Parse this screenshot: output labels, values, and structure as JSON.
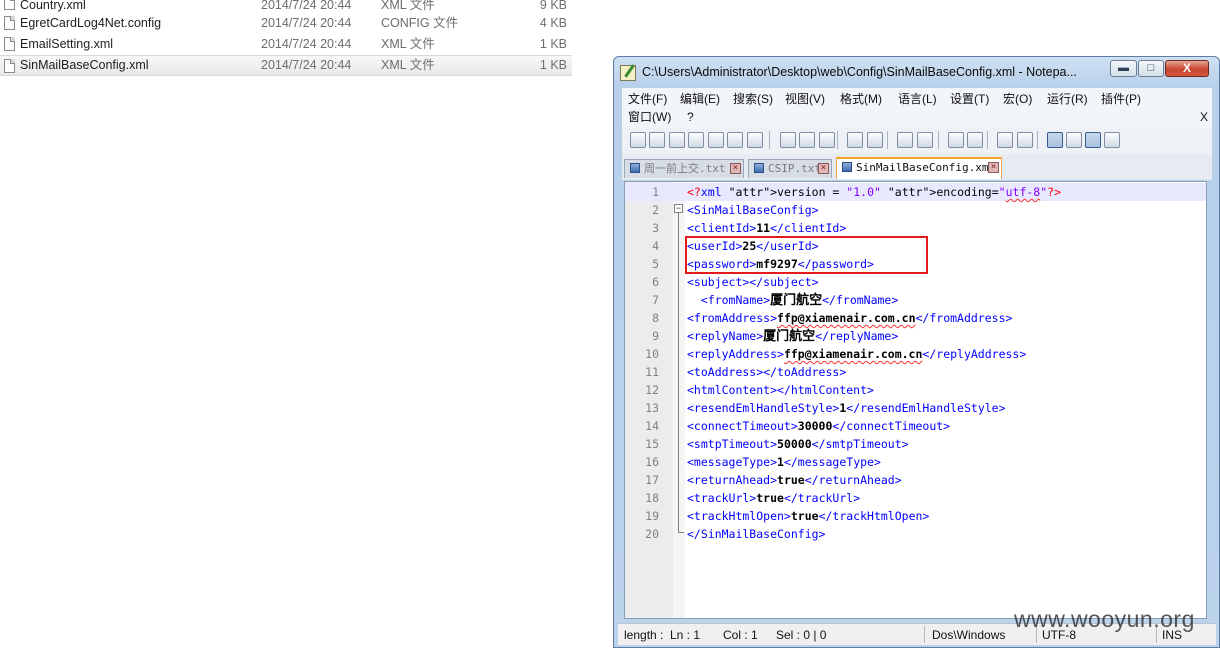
{
  "files": [
    {
      "name": "Country.xml",
      "date": "2014/7/24 20:44",
      "type": "XML 文件",
      "size": "9 KB"
    },
    {
      "name": "EgretCardLog4Net.config",
      "date": "2014/7/24 20:44",
      "type": "CONFIG 文件",
      "size": "4 KB"
    },
    {
      "name": "EmailSetting.xml",
      "date": "2014/7/24 20:44",
      "type": "XML 文件",
      "size": "1 KB"
    },
    {
      "name": "SinMailBaseConfig.xml",
      "date": "2014/7/24 20:44",
      "type": "XML 文件",
      "size": "1 KB"
    }
  ],
  "window": {
    "title": "C:\\Users\\Administrator\\Desktop\\web\\Config\\SinMailBaseConfig.xml - Notepa...",
    "close_glyph": "X"
  },
  "menu": {
    "items": [
      "文件(F)",
      "编辑(E)",
      "搜索(S)",
      "视图(V)",
      "格式(M)",
      "语言(L)",
      "设置(T)",
      "宏(O)",
      "运行(R)",
      "插件(P)",
      "窗口(W)",
      "?"
    ],
    "close": "X"
  },
  "toolbar": {
    "icons": [
      "new-file-icon",
      "open-file-icon",
      "save-icon",
      "save-all-icon",
      "close-file-icon",
      "close-all-icon",
      "print-icon",
      "cut-icon",
      "copy-icon",
      "paste-icon",
      "undo-icon",
      "redo-icon",
      "find-icon",
      "replace-icon",
      "zoom-in-icon",
      "zoom-out-icon",
      "sync-vertical-icon",
      "sync-horizontal-icon",
      "word-wrap-icon",
      "show-all-chars-icon",
      "indent-guide-icon",
      "user-lang-icon"
    ]
  },
  "tabs": [
    {
      "label": "周一前上交.txt",
      "active": false
    },
    {
      "label": "CSIP.txt",
      "active": false
    },
    {
      "label": "SinMailBaseConfig.xml",
      "active": true
    }
  ],
  "editor": {
    "current_line": 1,
    "lines": [
      "<?xml version = \"1.0\" encoding=\"utf-8\"?>",
      "<SinMailBaseConfig>",
      "<clientId>11</clientId>",
      "<userId>25</userId>",
      "<password>mf9297</password>",
      "<subject></subject>",
      "  <fromName>厦门航空</fromName>",
      "<fromAddress>ffp@xiamenair.com.cn</fromAddress>",
      "<replyName>厦门航空</replyName>",
      "<replyAddress>ffp@xiamenair.com.cn</replyAddress>",
      "<toAddress></toAddress>",
      "<htmlContent></htmlContent>",
      "<resendEmlHandleStyle>1</resendEmlHandleStyle>",
      "<connectTimeout>30000</connectTimeout>",
      "<smtpTimeout>50000</smtpTimeout>",
      "<messageType>1</messageType>",
      "<returnAhead>true</returnAhead>",
      "<trackUrl>true</trackUrl>",
      "<trackHtmlOpen>true</trackHtmlOpen>",
      "</SinMailBaseConfig>"
    ],
    "highlight_color": "#e41b1b"
  },
  "status": {
    "length": "length :",
    "line": "Ln : 1",
    "col": "Col : 1",
    "sel": "Sel : 0 | 0",
    "eol": "Dos\\Windows",
    "encoding": "UTF-8",
    "mode": "INS"
  },
  "watermark": "www.wooyun.org"
}
